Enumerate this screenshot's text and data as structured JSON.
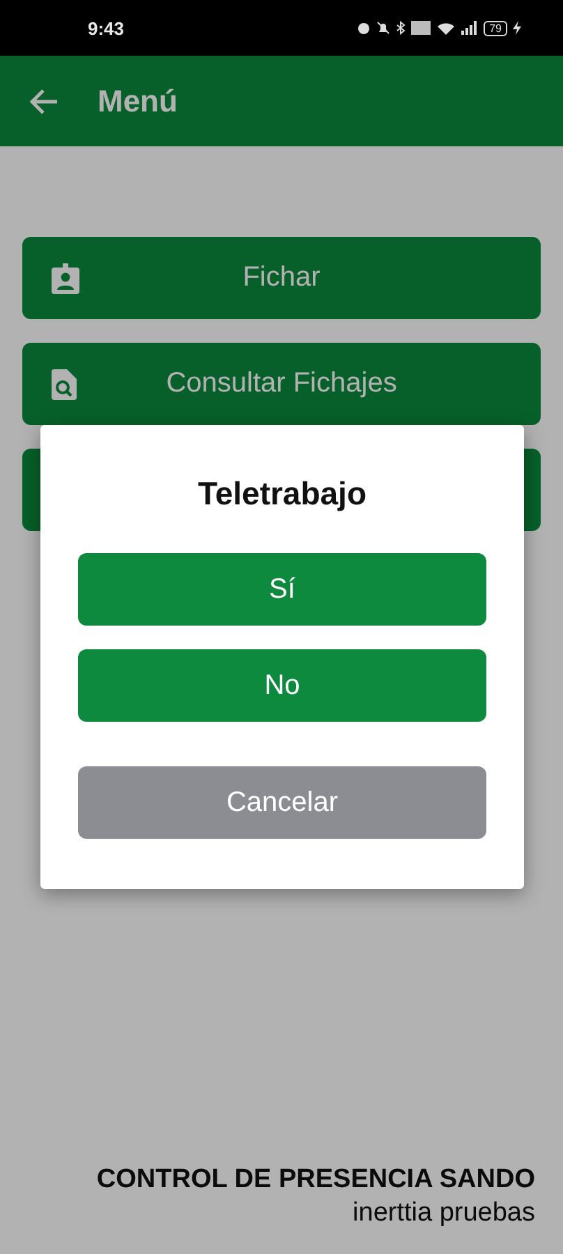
{
  "status_bar": {
    "time": "9:43",
    "battery": "79"
  },
  "app_bar": {
    "title": "Menú"
  },
  "menu": [
    {
      "kind": "badge",
      "label": "Fichar"
    },
    {
      "kind": "search",
      "label": "Consultar Fichajes"
    },
    {
      "kind": "covered"
    }
  ],
  "dialog": {
    "title": "Teletrabajo",
    "buttons": [
      {
        "label": "Sí",
        "kind": "primary"
      },
      {
        "label": "No",
        "kind": "primary"
      },
      {
        "label": "Cancelar",
        "kind": "cancel"
      }
    ]
  },
  "footer": {
    "company": "CONTROL DE PRESENCIA SANDO",
    "environment": "inerttia pruebas"
  }
}
